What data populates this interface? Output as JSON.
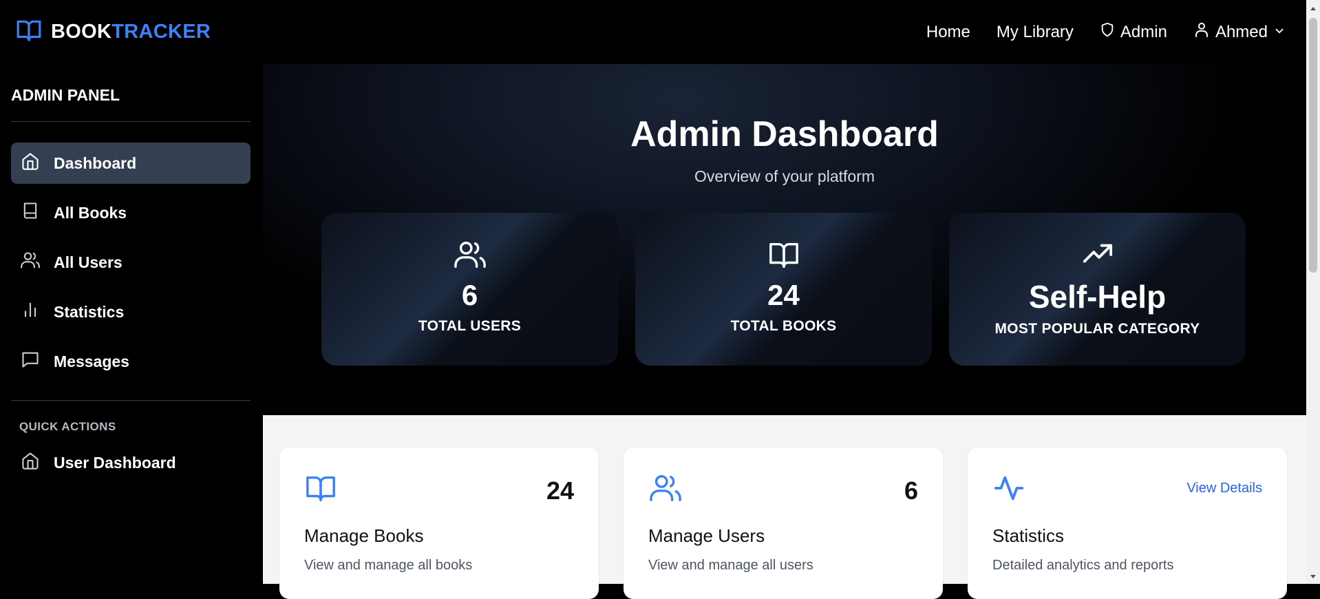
{
  "brand": {
    "part1": "BOOK",
    "part2": "TRACKER",
    "accent_color": "#3b82f6",
    "icon": "book-open-icon"
  },
  "nav": {
    "home": "Home",
    "library": "My Library",
    "admin": "Admin",
    "user": "Ahmed"
  },
  "sidebar": {
    "title": "ADMIN PANEL",
    "items": [
      {
        "label": "Dashboard",
        "icon": "home-icon",
        "active": true
      },
      {
        "label": "All Books",
        "icon": "book-icon"
      },
      {
        "label": "All Users",
        "icon": "users-icon"
      },
      {
        "label": "Statistics",
        "icon": "bar-chart-icon"
      },
      {
        "label": "Messages",
        "icon": "message-icon"
      }
    ],
    "quick_actions_title": "QUICK ACTIONS",
    "quick_actions": [
      {
        "label": "User Dashboard",
        "icon": "home-icon"
      }
    ]
  },
  "hero": {
    "title": "Admin Dashboard",
    "subtitle": "Overview of your platform",
    "stats": [
      {
        "icon": "users-icon",
        "value": "6",
        "label": "TOTAL USERS"
      },
      {
        "icon": "book-open-icon",
        "value": "24",
        "label": "TOTAL BOOKS"
      },
      {
        "icon": "trending-up-icon",
        "value": "Self-Help",
        "label": "MOST POPULAR CATEGORY"
      }
    ]
  },
  "cards": [
    {
      "icon": "book-open-icon",
      "count": "24",
      "title": "Manage Books",
      "description": "View and manage all books"
    },
    {
      "icon": "users-icon",
      "count": "6",
      "title": "Manage Users",
      "description": "View and manage all users"
    },
    {
      "icon": "activity-icon",
      "link": "View Details",
      "title": "Statistics",
      "description": "Detailed analytics and reports"
    }
  ],
  "colors": {
    "link": "#2563eb",
    "card_icon": "#3b82f6",
    "active_bg": "#344052"
  }
}
